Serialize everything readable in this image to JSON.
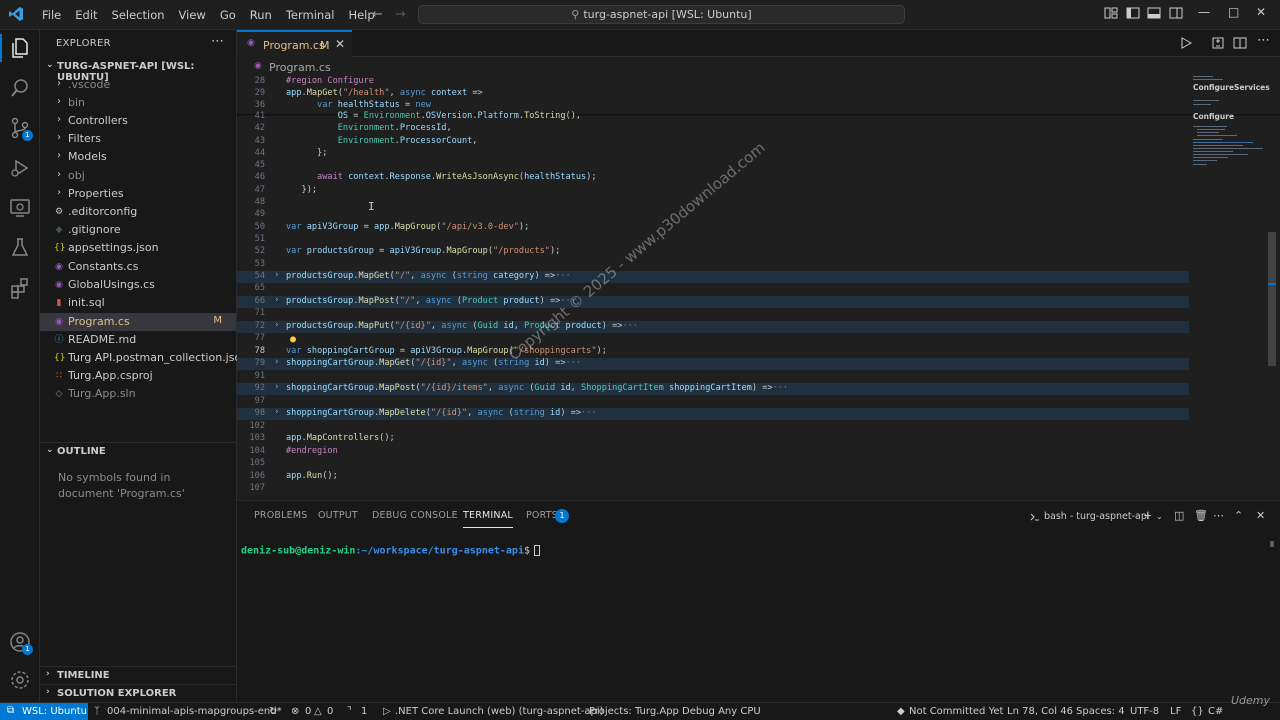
{
  "titlebar": {
    "menu": [
      "File",
      "Edit",
      "Selection",
      "View",
      "Go",
      "Run",
      "Terminal",
      "Help"
    ],
    "command_center": "turg-aspnet-api [WSL: Ubuntu]",
    "vscode_icon": "vscode-logo-icon"
  },
  "explorer": {
    "header": "EXPLORER",
    "root": "TURG-ASPNET-API [WSL: UBUNTU]",
    "items": [
      {
        "label": ".vscode",
        "kind": "folder"
      },
      {
        "label": "bin",
        "kind": "folder"
      },
      {
        "label": "Controllers",
        "kind": "folder"
      },
      {
        "label": "Filters",
        "kind": "folder"
      },
      {
        "label": "Models",
        "kind": "folder"
      },
      {
        "label": "obj",
        "kind": "folder"
      },
      {
        "label": "Properties",
        "kind": "folder"
      },
      {
        "label": ".editorconfig",
        "kind": "file"
      },
      {
        "label": ".gitignore",
        "kind": "file"
      },
      {
        "label": "appsettings.json",
        "kind": "file"
      },
      {
        "label": "Constants.cs",
        "kind": "file"
      },
      {
        "label": "GlobalUsings.cs",
        "kind": "file"
      },
      {
        "label": "init.sql",
        "kind": "file"
      },
      {
        "label": "Program.cs",
        "kind": "file",
        "status": "M"
      },
      {
        "label": "README.md",
        "kind": "file"
      },
      {
        "label": "Turg API.postman_collection.json",
        "kind": "file"
      },
      {
        "label": "Turg.App.csproj",
        "kind": "file"
      },
      {
        "label": "Turg.App.sln",
        "kind": "file"
      }
    ]
  },
  "outline": {
    "header": "OUTLINE",
    "message": "No symbols found in document 'Program.cs'"
  },
  "timeline": {
    "header": "TIMELINE"
  },
  "solution_explorer": {
    "header": "SOLUTION EXPLORER"
  },
  "tab": {
    "label": "Program.cs",
    "status": "M"
  },
  "breadcrumb": {
    "file": "Program.cs"
  },
  "editor": {
    "line_numbers": [
      "28",
      "29",
      "36",
      "41",
      "42",
      "43",
      "44",
      "45",
      "46",
      "47",
      "48",
      "49",
      "50",
      "51",
      "52",
      "53",
      "54",
      "65",
      "66",
      "71",
      "72",
      "77",
      "78",
      "79",
      "91",
      "92",
      "97",
      "98",
      "102",
      "103",
      "104",
      "105",
      "106",
      "107"
    ],
    "current_line": "78"
  },
  "minimap": {
    "labels": [
      "ConfigureServices",
      "Configure"
    ]
  },
  "watermark": {
    "text": "Copyright © 2025 - www.p30download.com"
  },
  "panel": {
    "tabs": [
      "PROBLEMS",
      "OUTPUT",
      "DEBUG CONSOLE",
      "TERMINAL",
      "PORTS"
    ],
    "active_tab": "TERMINAL",
    "ports_badge": "1",
    "terminal_name": "bash - turg-aspnet-api",
    "prompt_user": "deniz-sub@deniz-win",
    "prompt_path": ":~/workspace/turg-aspnet-api",
    "prompt_sign": "$"
  },
  "statusbar": {
    "remote": "WSL: Ubuntu",
    "branch": "004-minimal-apis-mapgroups-end*",
    "errors": "0",
    "warnings": "0",
    "ports": "1",
    "launch": ".NET Core Launch (web) (turg-aspnet-api)",
    "projects": "Projects: Turg.App",
    "debug": "Debug Any CPU",
    "blame": "Not Committed Yet",
    "position": "Ln 78, Col 46",
    "spaces": "Spaces: 4",
    "encoding": "UTF-8",
    "eol": "LF",
    "language": "C#"
  },
  "overlay": {
    "udemy": "Udemy"
  },
  "colors": {
    "accent": "#0078d4",
    "modified": "#e2c08d",
    "editor_bg": "#1f1f1f",
    "sidebar_bg": "#181818"
  }
}
